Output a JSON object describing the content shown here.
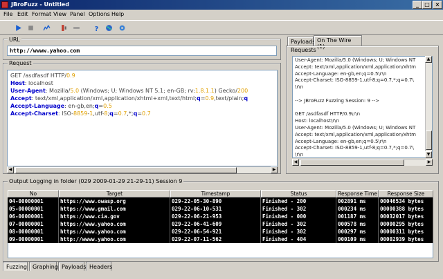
{
  "window": {
    "title": "JBroFuzz - Untitled",
    "min": "_",
    "max": "□",
    "close": "×"
  },
  "menu": [
    "File",
    "Edit",
    "Format",
    "View",
    "Panel",
    "Options",
    "Help"
  ],
  "toolbar_icons": [
    "play-icon",
    "stop-icon",
    "graph-icon",
    "fuzzer-icon",
    "remove-icon",
    "help-icon",
    "globe-icon",
    "settings-icon"
  ],
  "url": {
    "label": "URL",
    "value": "http://wwww.yahoo.com"
  },
  "request": {
    "label": "Request",
    "lines": [
      [
        [
          "GET /asdfasdf HTTP/",
          "v"
        ],
        [
          "0.9",
          "n"
        ]
      ],
      [
        [
          "Host",
          "k"
        ],
        [
          ": localhost",
          "v"
        ]
      ],
      [
        [
          "User-Agent",
          "k"
        ],
        [
          ": Mozilla/",
          "v"
        ],
        [
          "5.0",
          "n"
        ],
        [
          " (Windows; U; Windows NT 5.1; en-GB; rv:",
          "v"
        ],
        [
          "1.8.1.1",
          "n"
        ],
        [
          ") Gecko/",
          "v"
        ],
        [
          "200",
          "n"
        ]
      ],
      [
        [
          "Accept",
          "k"
        ],
        [
          ": text/xml,application/xml,application/xhtml+xml,text/html;",
          "v"
        ],
        [
          "q",
          "k"
        ],
        [
          "=",
          "v"
        ],
        [
          "0.9",
          "n"
        ],
        [
          ",text/plain;",
          "v"
        ],
        [
          "q",
          "k"
        ]
      ],
      [
        [
          "Accept-Language",
          "k"
        ],
        [
          ": en-gb,en;",
          "v"
        ],
        [
          "q",
          "k"
        ],
        [
          "=",
          "v"
        ],
        [
          "0.5",
          "n"
        ]
      ],
      [
        [
          "Accept-Charset",
          "k"
        ],
        [
          ": ISO-",
          "v"
        ],
        [
          "8859",
          "n"
        ],
        [
          "-",
          "v"
        ],
        [
          "1",
          "n"
        ],
        [
          ",utf-",
          "v"
        ],
        [
          "8",
          "n"
        ],
        [
          ";",
          "v"
        ],
        [
          "q",
          "k"
        ],
        [
          "=",
          "v"
        ],
        [
          "0.7",
          "n"
        ],
        [
          ",*;",
          "v"
        ],
        [
          "q",
          "k"
        ],
        [
          "=",
          "v"
        ],
        [
          "0.7",
          "n"
        ]
      ]
    ]
  },
  "right_tabs": [
    {
      "label": "Payloads",
      "active": false
    },
    {
      "label": "On The Wire (1)",
      "active": true
    }
  ],
  "wire": {
    "label": "Requests",
    "lines": [
      "User-Agent: Mozilla/5.0 (Windows; U; Windows NT",
      "Accept: text/xml,application/xml,application/xhtm",
      "Accept-Language: en-gb,en;q=0.5\\r\\n",
      "Accept-Charset: ISO-8859-1,utf-8;q=0.7,*;q=0.7\\",
      "\\r\\n",
      "",
      "--> JBroFuzz Fuzzing Session: 9 -->",
      "",
      "GET /asdfasdf HTTP/0.9\\r\\n",
      "Host: localhost\\r\\n",
      "User-Agent: Mozilla/5.0 (Windows; U; Windows NT",
      "Accept: text/xml,application/xml,application/xhtm",
      "Accept-Language: en-gb,en;q=0.5\\r\\n",
      "Accept-Charset: ISO-8859-1,utf-8;q=0.7,*;q=0.7\\",
      "\\r\\n"
    ]
  },
  "output": {
    "label": "Output  Logging in folder (029 2009-01-29 21-29-11) Session 9",
    "columns": [
      "No",
      "Target",
      "Timestamp",
      "Status",
      "Response Time",
      "Response Size"
    ],
    "rows": [
      [
        "04-00000001",
        "https://www.owasp.org",
        "029-22-05-30-890",
        "Finished - 200",
        "002891 ms",
        "00046534 bytes"
      ],
      [
        "05-00000001",
        "https://www.gmail.com",
        "029-22-06-10-531",
        "Finished - 302",
        "000234 ms",
        "00000388 bytes"
      ],
      [
        "06-00000001",
        "https://www.cia.gov",
        "029-22-06-21-953",
        "Finished - 000",
        "001187 ms",
        "00032017 bytes"
      ],
      [
        "07-00000001",
        "https://www.yahoo.com",
        "029-22-06-41-609",
        "Finished - 302",
        "000578 ms",
        "00000295 bytes"
      ],
      [
        "08-00000001",
        "https://www.yahoo.com",
        "029-22-06-54-921",
        "Finished - 302",
        "000297 ms",
        "00000311 bytes"
      ],
      [
        "09-00000001",
        "http://wwww.yahoo.com",
        "029-22-07-11-562",
        "Finished - 404",
        "000109 ms",
        "00002939 bytes"
      ]
    ]
  },
  "bottom_tabs": [
    {
      "label": "Fuzzing",
      "active": true
    },
    {
      "label": "Graphing",
      "active": false
    },
    {
      "label": "Payloads",
      "active": false
    },
    {
      "label": "Headers",
      "active": false
    }
  ],
  "colors": {
    "title_start": "#0a246a",
    "title_end": "#3a6ea5",
    "keyword": "#0000cc",
    "number": "#e0a000"
  }
}
